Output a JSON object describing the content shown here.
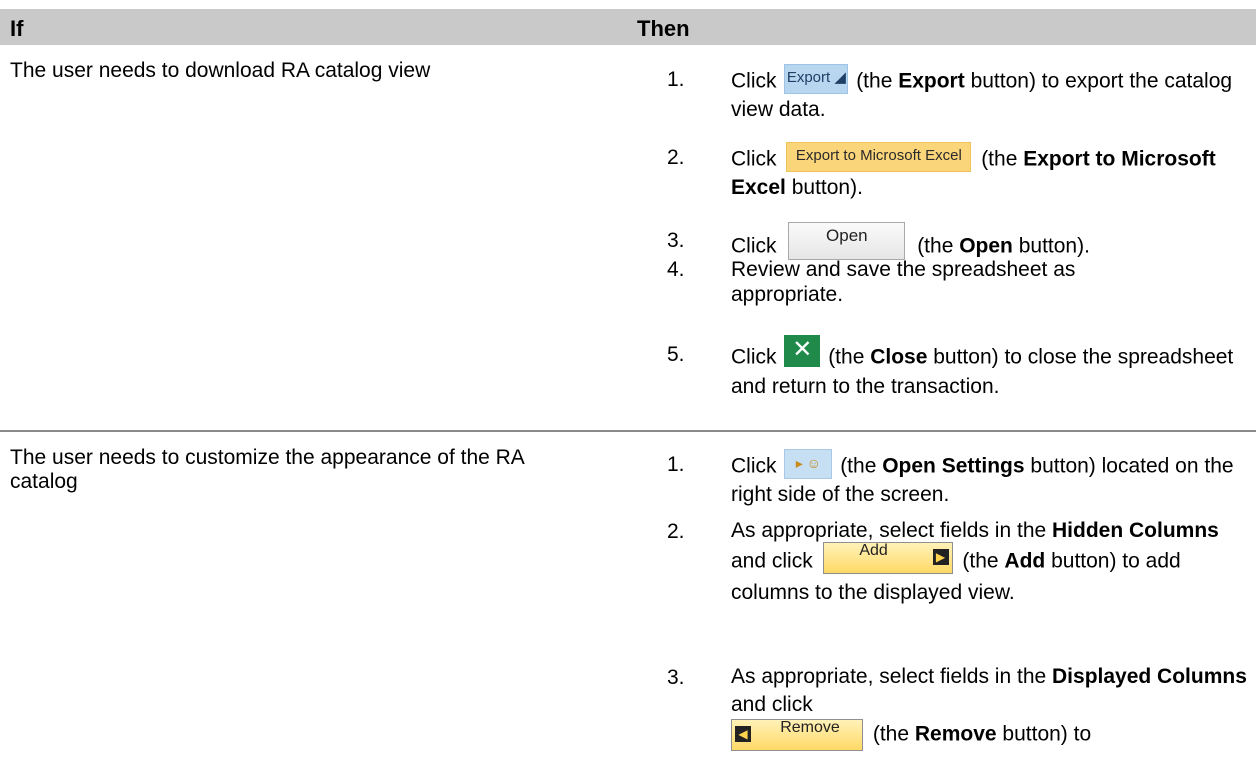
{
  "header": {
    "if": "If",
    "then": "Then"
  },
  "rows": [
    {
      "if": "The user needs to download RA catalog view",
      "steps": [
        {
          "num": "1.",
          "pre": "Click",
          "button": "Export ◢",
          "post_plain": "(the ",
          "bold": "Export",
          "post": " button) to export the catalog view data."
        },
        {
          "num": "2.",
          "pre": "Click",
          "button": "Export to Microsoft Excel",
          "post_plain": "(the ",
          "bold": "Export to Microsoft Excel",
          "post": " button)."
        },
        {
          "num": "3.",
          "pre": "Click",
          "button": "Open",
          "post_plain": "(the ",
          "bold": "Open",
          "post": " button)."
        },
        {
          "num": "4.",
          "text": "Review and save the spreadsheet as appropriate."
        },
        {
          "num": "5.",
          "pre": "Click",
          "button": "✕",
          "post_plain": "(the ",
          "bold": "Close",
          "post": " button) to close the spreadsheet and return to the transaction."
        }
      ]
    },
    {
      "if": "The user needs to customize the appearance of the RA catalog",
      "steps": [
        {
          "num": "1.",
          "pre": "Click",
          "button": "▸ ☺",
          "post_plain": "(the ",
          "bold": "Open Settings",
          "post": " button) located on the right side of the screen."
        },
        {
          "num": "2.",
          "pre": "As appropriate, select fields in the ",
          "bold1": "Hidden Columns",
          "mid": " and click",
          "button": "Add",
          "button_arrow": "▶",
          "post_plain": "(the ",
          "bold": "Add",
          "post": " button) to add columns to the displayed view."
        },
        {
          "num": "3.",
          "pre": "As appropriate, select fields in the ",
          "bold1": "Displayed Columns",
          "mid": " and click",
          "button": "Remove",
          "button_arrow": "◀",
          "post_plain": "(the ",
          "bold": "Remove",
          "post": " button) to"
        }
      ]
    }
  ],
  "colors": {
    "header_bg": "#c9c9c9",
    "export_button": "#b8d6f0",
    "excel_button": "#fbd57a",
    "close_button": "#1f8a4a",
    "add_remove_button": "#ffd966"
  },
  "icons": {
    "close": "excel-close-x-icon",
    "settings": "open-settings-icon",
    "add_arrow": "right-arrow-icon",
    "remove_arrow": "left-arrow-icon"
  }
}
